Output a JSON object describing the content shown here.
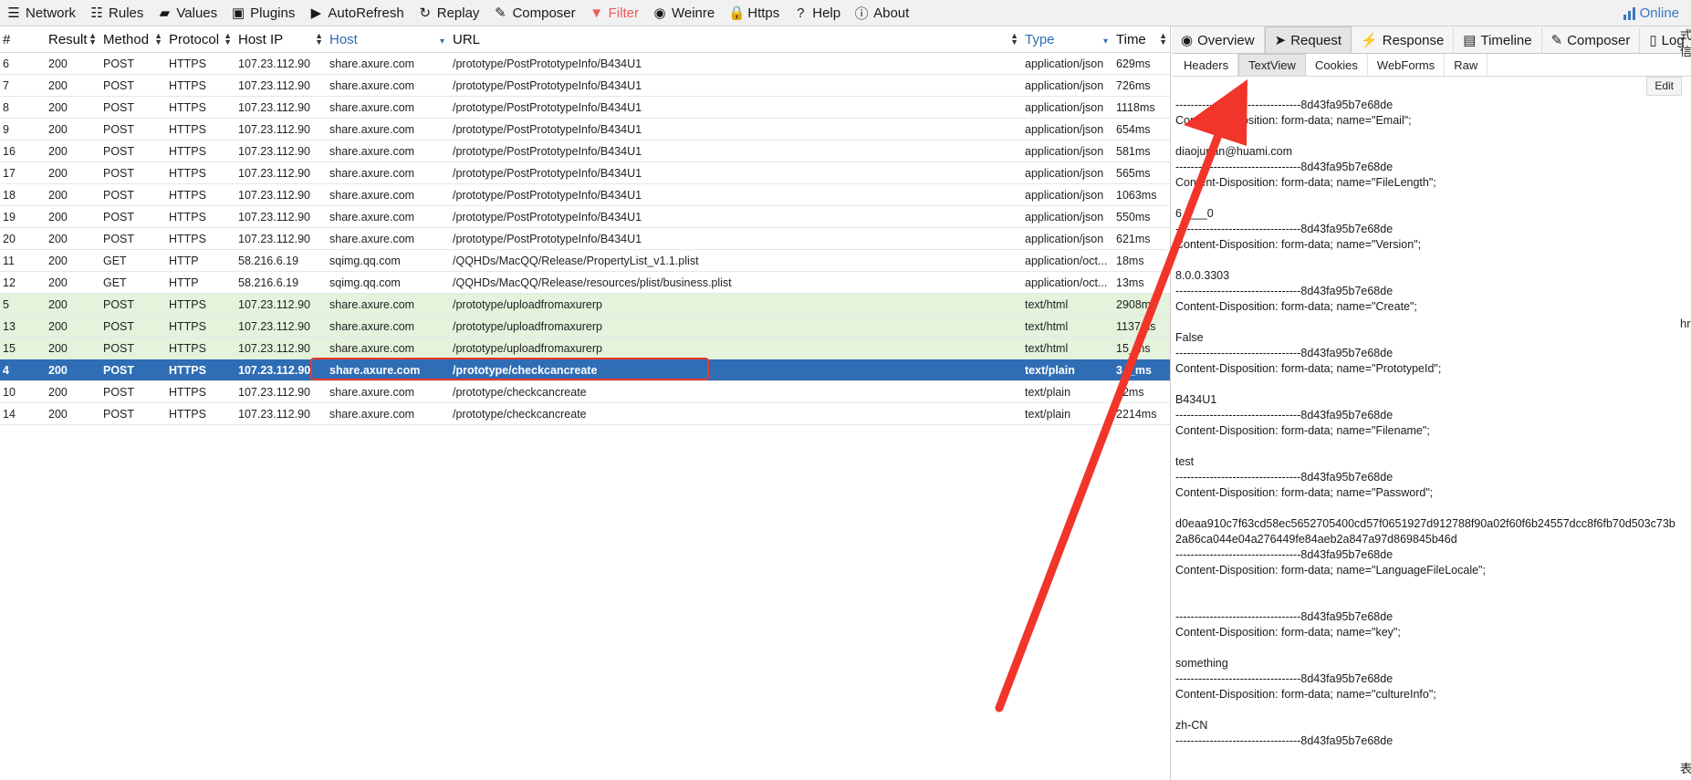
{
  "toolbar": {
    "items": [
      {
        "label": "Network",
        "icon": "☰"
      },
      {
        "label": "Rules",
        "icon": "☷"
      },
      {
        "label": "Values",
        "icon": "▰"
      },
      {
        "label": "Plugins",
        "icon": "▣"
      },
      {
        "label": "AutoRefresh",
        "icon": "▶"
      },
      {
        "label": "Replay",
        "icon": "↻"
      },
      {
        "label": "Composer",
        "icon": "✎"
      },
      {
        "label": "Filter",
        "icon": "▼"
      },
      {
        "label": "Weinre",
        "icon": "◉"
      },
      {
        "label": "Https",
        "icon": "🔒"
      },
      {
        "label": "Help",
        "icon": "?"
      },
      {
        "label": "About",
        "icon": "ⓘ"
      }
    ],
    "online_label": "Online",
    "filter_color": "#f05a5a"
  },
  "table": {
    "columns": [
      "#",
      "Result",
      "Method",
      "Protocol",
      "Host IP",
      "Host",
      "URL",
      "Type",
      "Time"
    ],
    "rows": [
      {
        "id": "6",
        "result": "200",
        "method": "POST",
        "protocol": "HTTPS",
        "ip": "107.23.112.90",
        "host": "share.axure.com",
        "url": "/prototype/PostPrototypeInfo/B434U1",
        "type": "application/json",
        "time": "629ms",
        "state": "normal"
      },
      {
        "id": "7",
        "result": "200",
        "method": "POST",
        "protocol": "HTTPS",
        "ip": "107.23.112.90",
        "host": "share.axure.com",
        "url": "/prototype/PostPrototypeInfo/B434U1",
        "type": "application/json",
        "time": "726ms",
        "state": "normal"
      },
      {
        "id": "8",
        "result": "200",
        "method": "POST",
        "protocol": "HTTPS",
        "ip": "107.23.112.90",
        "host": "share.axure.com",
        "url": "/prototype/PostPrototypeInfo/B434U1",
        "type": "application/json",
        "time": "1118ms",
        "state": "normal"
      },
      {
        "id": "9",
        "result": "200",
        "method": "POST",
        "protocol": "HTTPS",
        "ip": "107.23.112.90",
        "host": "share.axure.com",
        "url": "/prototype/PostPrototypeInfo/B434U1",
        "type": "application/json",
        "time": "654ms",
        "state": "normal"
      },
      {
        "id": "16",
        "result": "200",
        "method": "POST",
        "protocol": "HTTPS",
        "ip": "107.23.112.90",
        "host": "share.axure.com",
        "url": "/prototype/PostPrototypeInfo/B434U1",
        "type": "application/json",
        "time": "581ms",
        "state": "normal"
      },
      {
        "id": "17",
        "result": "200",
        "method": "POST",
        "protocol": "HTTPS",
        "ip": "107.23.112.90",
        "host": "share.axure.com",
        "url": "/prototype/PostPrototypeInfo/B434U1",
        "type": "application/json",
        "time": "565ms",
        "state": "normal"
      },
      {
        "id": "18",
        "result": "200",
        "method": "POST",
        "protocol": "HTTPS",
        "ip": "107.23.112.90",
        "host": "share.axure.com",
        "url": "/prototype/PostPrototypeInfo/B434U1",
        "type": "application/json",
        "time": "1063ms",
        "state": "normal"
      },
      {
        "id": "19",
        "result": "200",
        "method": "POST",
        "protocol": "HTTPS",
        "ip": "107.23.112.90",
        "host": "share.axure.com",
        "url": "/prototype/PostPrototypeInfo/B434U1",
        "type": "application/json",
        "time": "550ms",
        "state": "normal"
      },
      {
        "id": "20",
        "result": "200",
        "method": "POST",
        "protocol": "HTTPS",
        "ip": "107.23.112.90",
        "host": "share.axure.com",
        "url": "/prototype/PostPrototypeInfo/B434U1",
        "type": "application/json",
        "time": "621ms",
        "state": "normal"
      },
      {
        "id": "11",
        "result": "200",
        "method": "GET",
        "protocol": "HTTP",
        "ip": "58.216.6.19",
        "host": "sqimg.qq.com",
        "url": "/QQHDs/MacQQ/Release/PropertyList_v1.1.plist",
        "type": "application/oct...",
        "time": "18ms",
        "state": "normal"
      },
      {
        "id": "12",
        "result": "200",
        "method": "GET",
        "protocol": "HTTP",
        "ip": "58.216.6.19",
        "host": "sqimg.qq.com",
        "url": "/QQHDs/MacQQ/Release/resources/plist/business.plist",
        "type": "application/oct...",
        "time": "13ms",
        "state": "normal"
      },
      {
        "id": "5",
        "result": "200",
        "method": "POST",
        "protocol": "HTTPS",
        "ip": "107.23.112.90",
        "host": "share.axure.com",
        "url": "/prototype/uploadfromaxurerp",
        "type": "text/html",
        "time": "2908ms",
        "state": "green"
      },
      {
        "id": "13",
        "result": "200",
        "method": "POST",
        "protocol": "HTTPS",
        "ip": "107.23.112.90",
        "host": "share.axure.com",
        "url": "/prototype/uploadfromaxurerp",
        "type": "text/html",
        "time": "1137ms",
        "state": "green"
      },
      {
        "id": "15",
        "result": "200",
        "method": "POST",
        "protocol": "HTTPS",
        "ip": "107.23.112.90",
        "host": "share.axure.com",
        "url": "/prototype/uploadfromaxurerp",
        "type": "text/html",
        "time": "15_ms",
        "state": "green"
      },
      {
        "id": "4",
        "result": "200",
        "method": "POST",
        "protocol": "HTTPS",
        "ip": "107.23.112.90",
        "host": "share.axure.com",
        "url": "/prototype/checkcancreate",
        "type": "text/plain",
        "time": "3__ms",
        "state": "selected"
      },
      {
        "id": "10",
        "result": "200",
        "method": "POST",
        "protocol": "HTTPS",
        "ip": "107.23.112.90",
        "host": "share.axure.com",
        "url": "/prototype/checkcancreate",
        "type": "text/plain",
        "time": "_2ms",
        "state": "normal"
      },
      {
        "id": "14",
        "result": "200",
        "method": "POST",
        "protocol": "HTTPS",
        "ip": "107.23.112.90",
        "host": "share.axure.com",
        "url": "/prototype/checkcancreate",
        "type": "text/plain",
        "time": "2214ms",
        "state": "normal"
      }
    ]
  },
  "inspector": {
    "tabs": [
      {
        "label": "Overview",
        "icon": "◉"
      },
      {
        "label": "Request",
        "icon": "➤"
      },
      {
        "label": "Response",
        "icon": "⚡"
      },
      {
        "label": "Timeline",
        "icon": "▤"
      },
      {
        "label": "Composer",
        "icon": "✎"
      },
      {
        "label": "Log",
        "icon": "▯"
      }
    ],
    "active_tab": "Request",
    "subtabs": [
      "Headers",
      "TextView",
      "Cookies",
      "WebForms",
      "Raw"
    ],
    "active_subtab": "TextView",
    "edit_label": "Edit",
    "body_lines": [
      "---------------------------------8d43fa95b7e68de",
      "Content-Disposition: form-data; name=\"Email\";",
      "",
      "diaojunan@huami.com",
      "---------------------------------8d43fa95b7e68de",
      "Content-Disposition: form-data; name=\"FileLength\";",
      "",
      "6____0",
      "---------------------------------8d43fa95b7e68de",
      "Content-Disposition: form-data; name=\"Version\";",
      "",
      "8.0.0.3303",
      "---------------------------------8d43fa95b7e68de",
      "Content-Disposition: form-data; name=\"Create\";",
      "",
      "False",
      "---------------------------------8d43fa95b7e68de",
      "Content-Disposition: form-data; name=\"PrototypeId\";",
      "",
      "B434U1",
      "---------------------------------8d43fa95b7e68de",
      "Content-Disposition: form-data; name=\"Filename\";",
      "",
      "test",
      "---------------------------------8d43fa95b7e68de",
      "Content-Disposition: form-data; name=\"Password\";",
      "",
      "d0eaa910c7f63cd58ec5652705400cd57f0651927d912788f90a02f60f6b24557dcc8f6fb70d503c73b2a86ca044e04a276449fe84aeb2a847a97d869845b46d",
      "---------------------------------8d43fa95b7e68de",
      "Content-Disposition: form-data; name=\"LanguageFileLocale\";",
      "",
      "",
      "---------------------------------8d43fa95b7e68de",
      "Content-Disposition: form-data; name=\"key\";",
      "",
      "something",
      "---------------------------------8d43fa95b7e68de",
      "Content-Disposition: form-data; name=\"cultureInfo\";",
      "",
      "zh-CN",
      "---------------------------------8d43fa95b7e68de"
    ]
  },
  "edge": [
    "式",
    "信",
    "hr",
    "表"
  ],
  "annotation_color": "#f2352a"
}
